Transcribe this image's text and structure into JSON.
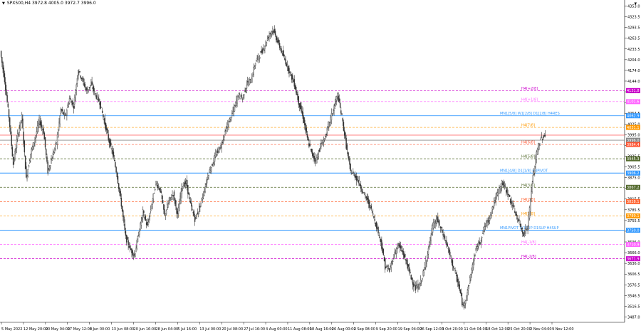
{
  "header": {
    "symbol_line": "SPX500,H4  3972.8 4005.0 3972.7 3996.0",
    "corner_glyph": "▾"
  },
  "chart_data": {
    "type": "candlestick",
    "title": "",
    "symbol": "SPX500",
    "timeframe": "H4",
    "ohlc_last": {
      "open": 3972.8,
      "high": 4005.0,
      "low": 3972.7,
      "close": 3996.0
    },
    "ylim": [
      3498,
      4364
    ],
    "y_ticks": [
      "4353.0",
      "4323.5",
      "4293.5",
      "4263.5",
      "4233.5",
      "4204.0",
      "4174.0",
      "4144.0",
      "4114.5",
      "4084.5",
      "4054.5",
      "4025.0",
      "3995.0",
      "3965.0",
      "3935.5",
      "3905.5",
      "3875.0",
      "3845.0",
      "3815.5",
      "3785.5",
      "3755.5",
      "3725.5",
      "3696.0",
      "3666.0",
      "3636.0",
      "3606.5",
      "3576.5",
      "3546.5",
      "3516.5",
      "3487.0"
    ],
    "x_ticks": [
      "5 May 2022",
      "12 May 20:00",
      "20 May 04:00",
      "27 May 12:00",
      "6 Jun 00:00",
      "13 Jun 08:00",
      "20 Jun 16:00",
      "28 Jun 04:00",
      "5 Jul 16:00",
      "13 Jul 00:00",
      "20 Jul 08:00",
      "27 Jul 16:00",
      "4 Aug 00:00",
      "11 Aug 08:00",
      "18 Aug 16:00",
      "26 Aug 00:00",
      "2 Sep 08:00",
      "9 Sep 20:00",
      "19 Sep 04:00",
      "26 Sep 12:00",
      "3 Oct 20:00",
      "11 Oct 04:00",
      "18 Oct 12:00",
      "25 Oct 20:00",
      "2 Nov 04:00",
      "9 Nov 12:00"
    ],
    "price_path": [
      [
        0,
        4240
      ],
      [
        4,
        4160
      ],
      [
        8,
        4060
      ],
      [
        12,
        3930
      ],
      [
        16,
        4010
      ],
      [
        20,
        4060
      ],
      [
        24,
        3890
      ],
      [
        28,
        3960
      ],
      [
        32,
        4000
      ],
      [
        36,
        4050
      ],
      [
        40,
        4020
      ],
      [
        44,
        3910
      ],
      [
        48,
        3950
      ],
      [
        52,
        3990
      ],
      [
        56,
        4080
      ],
      [
        60,
        4060
      ],
      [
        64,
        4110
      ],
      [
        68,
        4090
      ],
      [
        72,
        4190
      ],
      [
        76,
        4160
      ],
      [
        80,
        4130
      ],
      [
        84,
        4150
      ],
      [
        88,
        4120
      ],
      [
        92,
        4100
      ],
      [
        96,
        4050
      ],
      [
        100,
        4000
      ],
      [
        104,
        3960
      ],
      [
        108,
        3900
      ],
      [
        112,
        3820
      ],
      [
        116,
        3730
      ],
      [
        120,
        3700
      ],
      [
        124,
        3680
      ],
      [
        128,
        3740
      ],
      [
        132,
        3800
      ],
      [
        136,
        3760
      ],
      [
        140,
        3820
      ],
      [
        144,
        3880
      ],
      [
        148,
        3860
      ],
      [
        152,
        3790
      ],
      [
        156,
        3830
      ],
      [
        160,
        3850
      ],
      [
        164,
        3790
      ],
      [
        168,
        3870
      ],
      [
        172,
        3880
      ],
      [
        176,
        3820
      ],
      [
        180,
        3780
      ],
      [
        184,
        3810
      ],
      [
        188,
        3850
      ],
      [
        192,
        3900
      ],
      [
        196,
        3930
      ],
      [
        200,
        3960
      ],
      [
        204,
        3980
      ],
      [
        208,
        4020
      ],
      [
        212,
        4050
      ],
      [
        216,
        4080
      ],
      [
        220,
        4120
      ],
      [
        224,
        4110
      ],
      [
        228,
        4150
      ],
      [
        232,
        4160
      ],
      [
        236,
        4210
      ],
      [
        240,
        4230
      ],
      [
        244,
        4250
      ],
      [
        248,
        4280
      ],
      [
        252,
        4300
      ],
      [
        256,
        4270
      ],
      [
        260,
        4240
      ],
      [
        264,
        4210
      ],
      [
        268,
        4180
      ],
      [
        272,
        4150
      ],
      [
        276,
        4100
      ],
      [
        280,
        4060
      ],
      [
        284,
        4000
      ],
      [
        288,
        3960
      ],
      [
        292,
        3940
      ],
      [
        296,
        3980
      ],
      [
        300,
        4000
      ],
      [
        304,
        4040
      ],
      [
        308,
        4080
      ],
      [
        312,
        4120
      ],
      [
        316,
        4060
      ],
      [
        320,
        3980
      ],
      [
        324,
        3910
      ],
      [
        328,
        3900
      ],
      [
        332,
        3880
      ],
      [
        336,
        3850
      ],
      [
        340,
        3830
      ],
      [
        344,
        3800
      ],
      [
        348,
        3760
      ],
      [
        352,
        3720
      ],
      [
        356,
        3650
      ],
      [
        360,
        3640
      ],
      [
        364,
        3680
      ],
      [
        368,
        3710
      ],
      [
        372,
        3690
      ],
      [
        376,
        3660
      ],
      [
        380,
        3620
      ],
      [
        384,
        3590
      ],
      [
        388,
        3600
      ],
      [
        392,
        3640
      ],
      [
        396,
        3700
      ],
      [
        400,
        3760
      ],
      [
        404,
        3780
      ],
      [
        408,
        3750
      ],
      [
        412,
        3720
      ],
      [
        416,
        3680
      ],
      [
        420,
        3640
      ],
      [
        424,
        3600
      ],
      [
        428,
        3540
      ],
      [
        432,
        3580
      ],
      [
        436,
        3640
      ],
      [
        440,
        3700
      ],
      [
        444,
        3720
      ],
      [
        448,
        3760
      ],
      [
        452,
        3780
      ],
      [
        456,
        3820
      ],
      [
        460,
        3850
      ],
      [
        464,
        3880
      ],
      [
        468,
        3860
      ],
      [
        472,
        3830
      ],
      [
        476,
        3800
      ],
      [
        480,
        3770
      ],
      [
        484,
        3740
      ],
      [
        488,
        3760
      ],
      [
        492,
        3880
      ],
      [
        496,
        3960
      ],
      [
        500,
        4000
      ],
      [
        504,
        4010
      ]
    ],
    "levels": [
      {
        "label": "H4[+2/8]",
        "price": 4131.8,
        "color": "#cc00cc",
        "style": "dashed",
        "tag": "4131.8"
      },
      {
        "label": "H4[+1/8]",
        "price": 4101.6,
        "color": "#ff66ff",
        "style": "dashed",
        "tag": "4101.6"
      },
      {
        "label": "MN1[5/8] W1[2/8] D1[2/8] H4RES",
        "price": 4062.9,
        "color": "#3399ff",
        "style": "solid",
        "tag": "4062.9"
      },
      {
        "label": "H4[7/8]",
        "price": 4031.1,
        "color": "#ff9900",
        "style": "dashed",
        "tag": "4031.1"
      },
      {
        "label": "",
        "price": 4010.0,
        "color": "#ff6666",
        "style": "solid",
        "tag": ""
      },
      {
        "label": "",
        "price": 3996.0,
        "color": "#888888",
        "style": "solid",
        "tag": "3996.0"
      },
      {
        "label": "H4[6/8]",
        "price": 3984.4,
        "color": "#ff5533",
        "style": "dashed",
        "tag": "3984.4"
      },
      {
        "label": "H4[5/8]",
        "price": 3945.3,
        "color": "#556b2f",
        "style": "dashed",
        "tag": "3945.3"
      },
      {
        "label": "MN1[4/8] D1[1/8] H4PIVOT",
        "price": 3906.2,
        "color": "#3399ff",
        "style": "solid",
        "tag": "3906.2"
      },
      {
        "label": "H4[3/8]",
        "price": 3867.2,
        "color": "#556b2f",
        "style": "dashed",
        "tag": "3867.2"
      },
      {
        "label": "H4[2/8]",
        "price": 3828.1,
        "color": "#ff6633",
        "style": "dashed",
        "tag": "3828.1"
      },
      {
        "label": "H4[1/8]",
        "price": 3789.1,
        "color": "#ff9900",
        "style": "dashed",
        "tag": "3789.1"
      },
      {
        "label": "MN1PIVOT W1SUP D1SUP H4SUP",
        "price": 3750.0,
        "color": "#3399ff",
        "style": "solid",
        "tag": "3750.0"
      },
      {
        "label": "H4[-1/8]",
        "price": 3710.9,
        "color": "#ff66ff",
        "style": "dashed",
        "tag": "3710.9"
      },
      {
        "label": "H4[-2/8]",
        "price": 3671.9,
        "color": "#cc00cc",
        "style": "dashed",
        "tag": "3671.9"
      }
    ],
    "grid": false,
    "colors": {
      "candle": "#333333",
      "background": "#ffffff",
      "axis": "#000000"
    }
  }
}
